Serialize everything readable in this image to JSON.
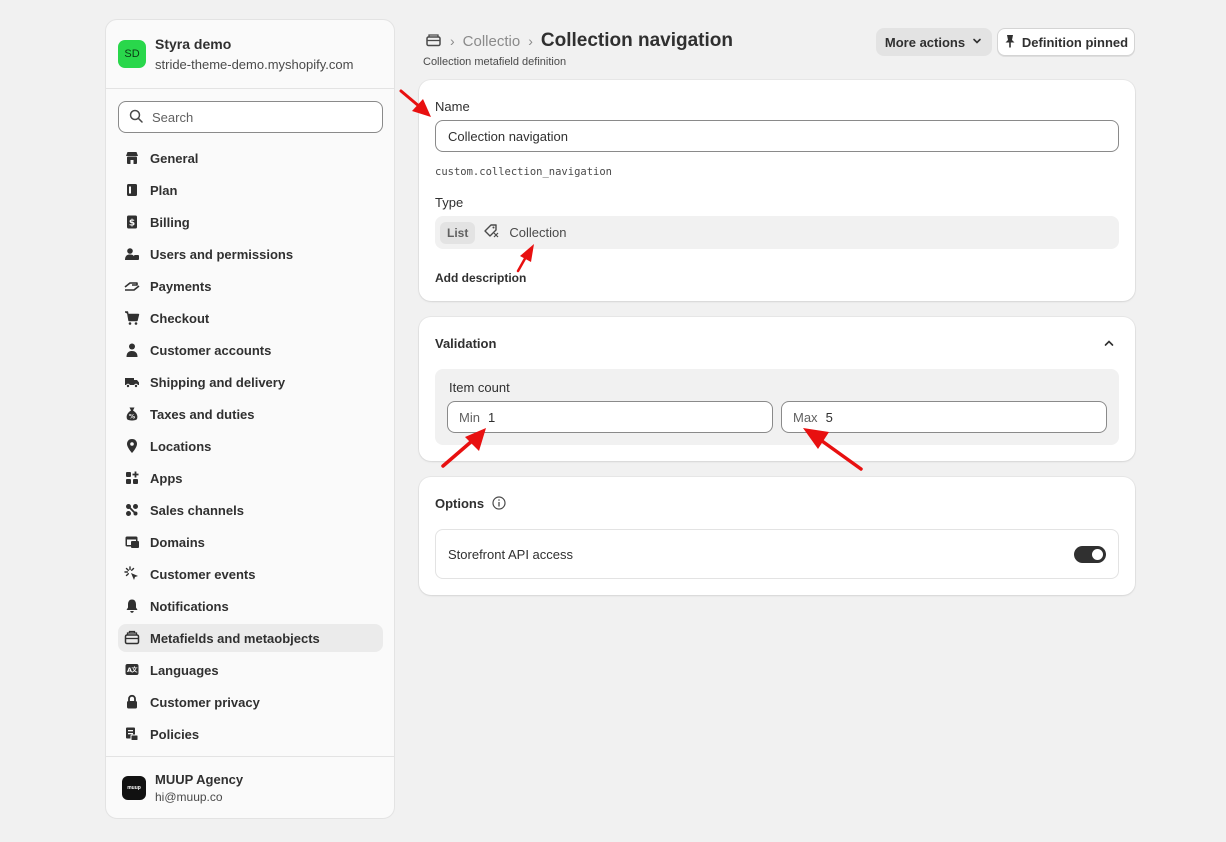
{
  "store": {
    "initials": "SD",
    "name": "Styra demo",
    "domain": "stride-theme-demo.myshopify.com",
    "avatar_color": "#29d74b"
  },
  "search": {
    "placeholder": "Search"
  },
  "nav": [
    {
      "label": "General",
      "icon": "store-icon"
    },
    {
      "label": "Plan",
      "icon": "plan-icon"
    },
    {
      "label": "Billing",
      "icon": "billing-icon"
    },
    {
      "label": "Users and permissions",
      "icon": "users-icon"
    },
    {
      "label": "Payments",
      "icon": "payments-icon"
    },
    {
      "label": "Checkout",
      "icon": "cart-icon"
    },
    {
      "label": "Customer accounts",
      "icon": "person-icon"
    },
    {
      "label": "Shipping and delivery",
      "icon": "truck-icon"
    },
    {
      "label": "Taxes and duties",
      "icon": "tax-icon"
    },
    {
      "label": "Locations",
      "icon": "location-icon"
    },
    {
      "label": "Apps",
      "icon": "apps-icon"
    },
    {
      "label": "Sales channels",
      "icon": "channels-icon"
    },
    {
      "label": "Domains",
      "icon": "domains-icon"
    },
    {
      "label": "Customer events",
      "icon": "cursor-icon"
    },
    {
      "label": "Notifications",
      "icon": "bell-icon"
    },
    {
      "label": "Metafields and metaobjects",
      "icon": "metafields-icon",
      "active": true
    },
    {
      "label": "Languages",
      "icon": "languages-icon"
    },
    {
      "label": "Customer privacy",
      "icon": "lock-icon"
    },
    {
      "label": "Policies",
      "icon": "policies-icon"
    }
  ],
  "account": {
    "logo_text": "muup",
    "name": "MUUP Agency",
    "email": "hi@muup.co"
  },
  "header": {
    "crumb": "Collectio",
    "title": "Collection navigation",
    "subtitle": "Collection metafield definition",
    "more_actions": "More actions",
    "pinned": "Definition pinned"
  },
  "definition": {
    "name_label": "Name",
    "name_value": "Collection navigation",
    "namespace_key": "custom.collection_navigation",
    "type_label": "Type",
    "type_badge": "List",
    "type_name": "Collection",
    "add_description": "Add description"
  },
  "validation": {
    "title": "Validation",
    "item_count_label": "Item count",
    "min_prefix": "Min",
    "min_value": "1",
    "max_prefix": "Max",
    "max_value": "5"
  },
  "options": {
    "title": "Options",
    "storefront_label": "Storefront API access",
    "storefront_enabled": true
  },
  "colors": {
    "background": "#f1f1f1",
    "text": "#303030",
    "annotation_arrow": "#e81010"
  }
}
